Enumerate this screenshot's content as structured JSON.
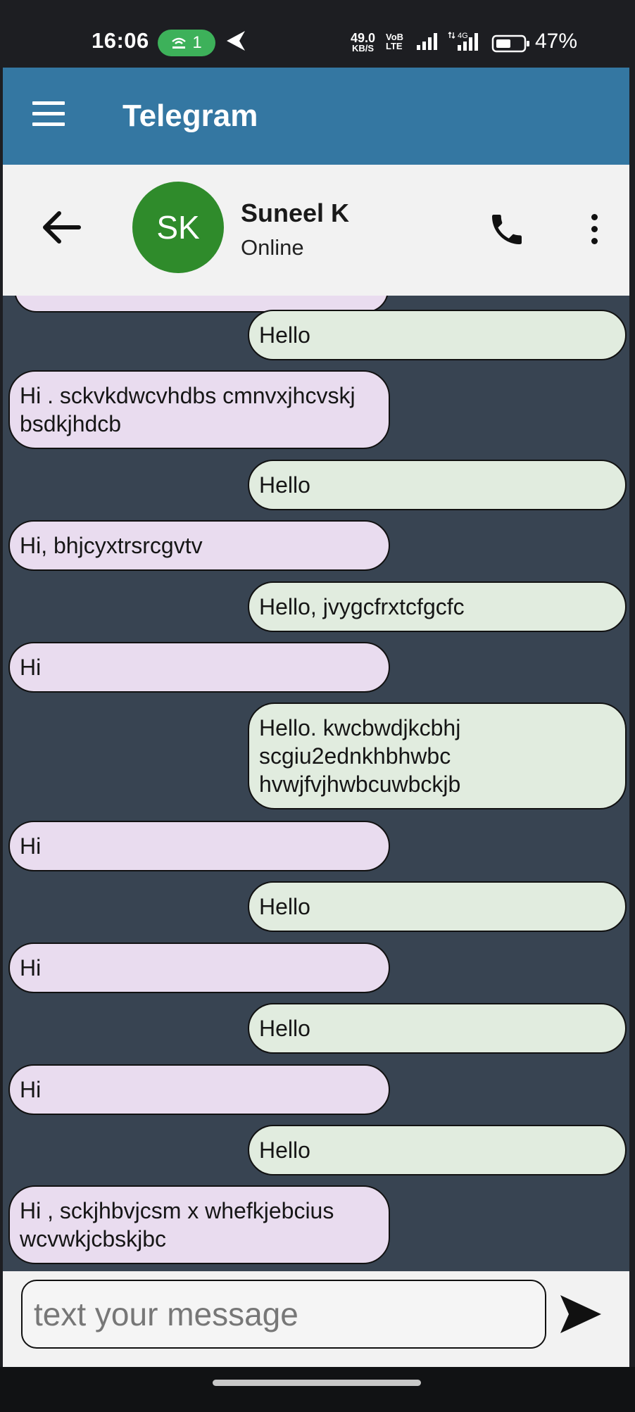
{
  "status_bar": {
    "time": "16:06",
    "hotspot_count": "1",
    "net_speed_value": "49.0",
    "net_speed_unit": "KB/S",
    "volte_top": "VoB",
    "volte_bottom": "LTE",
    "battery": "47%"
  },
  "app_bar": {
    "title": "Telegram"
  },
  "chat_header": {
    "avatar_initials": "SK",
    "contact_name": "Suneel K",
    "contact_status": "Online"
  },
  "messages": [
    {
      "side": "out",
      "text": "Hello"
    },
    {
      "side": "in",
      "text": "Hi . sckvkdwcvhdbs cmnvxjhcvskj bsdkjhdcb"
    },
    {
      "side": "out",
      "text": "Hello"
    },
    {
      "side": "in",
      "text": "Hi, bhjcyxtrsrcgvtv"
    },
    {
      "side": "out",
      "text": "Hello, jvygcfrxtcfgcfc"
    },
    {
      "side": "in",
      "text": "Hi"
    },
    {
      "side": "out",
      "text": "Hello. kwcbwdjkcbhj scgiu2ednkhbhwbc hvwjfvjhwbcuwbckjb"
    },
    {
      "side": "in",
      "text": "Hi"
    },
    {
      "side": "out",
      "text": "Hello"
    },
    {
      "side": "in",
      "text": "Hi"
    },
    {
      "side": "out",
      "text": "Hello"
    },
    {
      "side": "in",
      "text": "Hi"
    },
    {
      "side": "out",
      "text": "Hello"
    },
    {
      "side": "in",
      "text": "Hi , sckjhbvjcsm x whefkjebcius wcvwkjcbskjbc"
    }
  ],
  "composer": {
    "placeholder": "text your message"
  },
  "colors": {
    "app_bar": "#3477a2",
    "chat_background": "#384452",
    "incoming_bubble": "#e9dcef",
    "outgoing_bubble": "#e1ecdf",
    "avatar": "#2f8b2b"
  }
}
